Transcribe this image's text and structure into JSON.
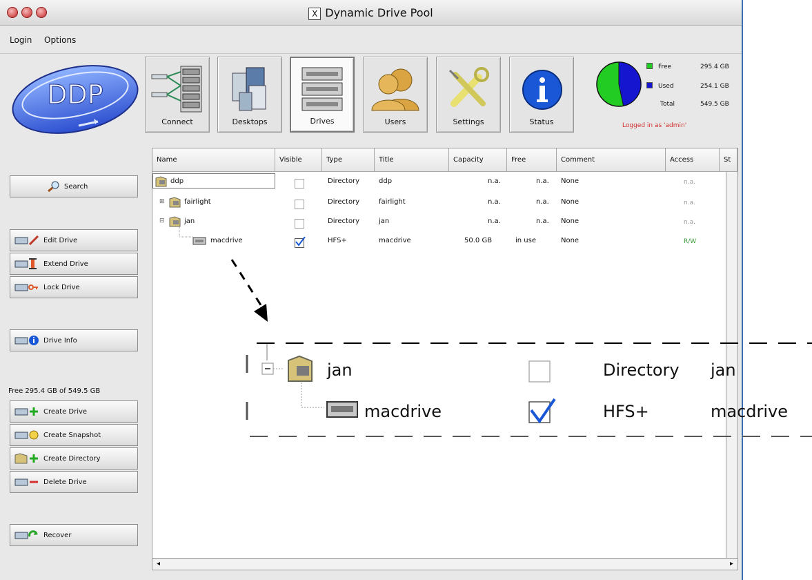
{
  "window": {
    "title": "Dynamic Drive Pool"
  },
  "menu": {
    "items": [
      "Login",
      "Options"
    ]
  },
  "logo": {
    "text": "DDP"
  },
  "toolbar": {
    "buttons": [
      {
        "label": "Connect"
      },
      {
        "label": "Desktops"
      },
      {
        "label": "Drives"
      },
      {
        "label": "Users"
      },
      {
        "label": "Settings"
      },
      {
        "label": "Status"
      }
    ]
  },
  "status": {
    "free_label": "Free",
    "free_value": "295.4 GB",
    "used_label": "Used",
    "used_value": "254.1 GB",
    "total_label": "Total",
    "total_value": "549.5 GB",
    "login_message": "Logged in as 'admin'",
    "free_color": "#22cc22",
    "used_color": "#1515d0"
  },
  "sidebar": {
    "search": "Search",
    "edit_drive": "Edit Drive",
    "extend_drive": "Extend Drive",
    "lock_drive": "Lock Drive",
    "drive_info": "Drive Info",
    "free_text": "Free 295.4 GB of 549.5 GB",
    "create_drive": "Create Drive",
    "create_snapshot": "Create Snapshot",
    "create_directory": "Create Directory",
    "delete_drive": "Delete Drive",
    "recover": "Recover"
  },
  "table": {
    "columns": [
      "Name",
      "Visible",
      "Type",
      "Title",
      "Capacity",
      "Free",
      "Comment",
      "Access",
      "St"
    ],
    "rows": [
      {
        "name": "ddp",
        "visible": false,
        "type": "Directory",
        "title": "ddp",
        "capacity": "n.a.",
        "free": "n.a.",
        "comment": "None",
        "access": "n.a."
      },
      {
        "name": "fairlight",
        "visible": false,
        "type": "Directory",
        "title": "fairlight",
        "capacity": "n.a.",
        "free": "n.a.",
        "comment": "None",
        "access": "n.a."
      },
      {
        "name": "jan",
        "visible": false,
        "type": "Directory",
        "title": "jan",
        "capacity": "n.a.",
        "free": "n.a.",
        "comment": "None",
        "access": "n.a."
      },
      {
        "name": "macdrive",
        "visible": true,
        "type": "HFS+",
        "title": "macdrive",
        "capacity": "50.0 GB",
        "free": "in use",
        "comment": "None",
        "access": "R/W"
      }
    ]
  },
  "zoom": {
    "row1": {
      "name": "jan",
      "type": "Directory",
      "title": "jan"
    },
    "row2": {
      "name": "macdrive",
      "type": "HFS+",
      "title": "macdrive"
    }
  }
}
